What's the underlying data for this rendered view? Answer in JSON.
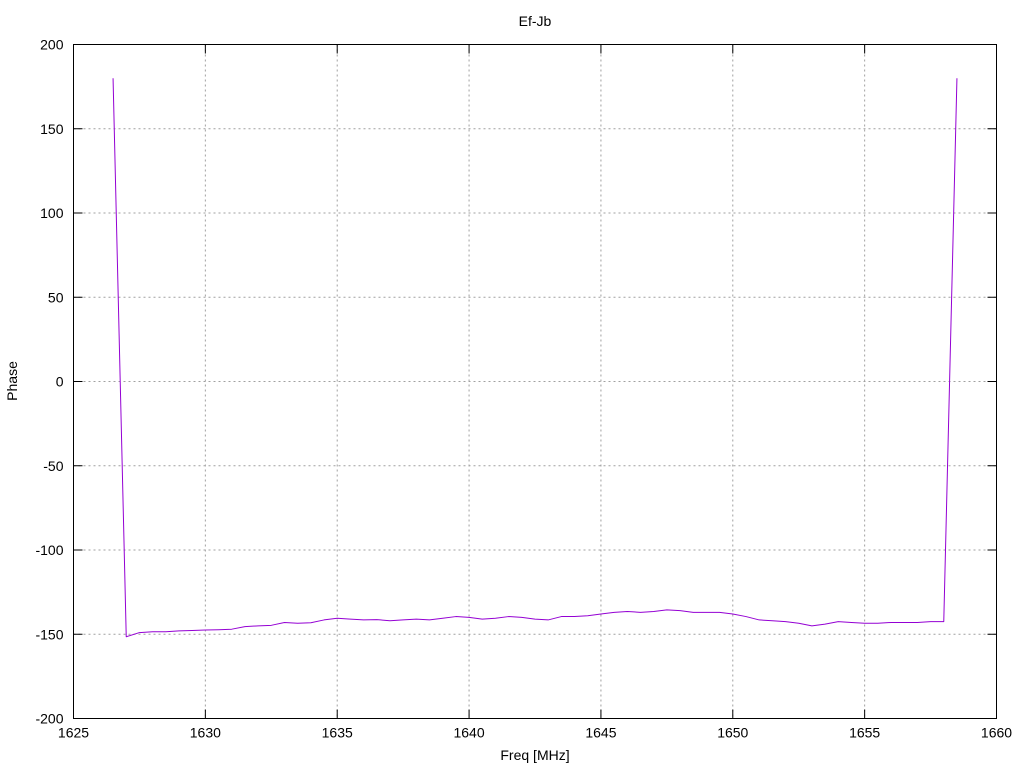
{
  "chart_data": {
    "type": "line",
    "title": "Ef-Jb",
    "xlabel": "Freq [MHz]",
    "ylabel": "Phase",
    "xlim": [
      1625,
      1660
    ],
    "ylim": [
      -200,
      200
    ],
    "xticks": [
      1625,
      1630,
      1635,
      1640,
      1645,
      1650,
      1655,
      1660
    ],
    "yticks": [
      -200,
      -150,
      -100,
      -50,
      0,
      50,
      100,
      150,
      200
    ],
    "grid": true,
    "legend": "none",
    "series": [
      {
        "color": "#9400d3",
        "x": [
          1626.5,
          1627.0,
          1627.5,
          1628.0,
          1628.5,
          1629.0,
          1629.5,
          1630.0,
          1630.5,
          1631.0,
          1631.5,
          1632.0,
          1632.5,
          1633.0,
          1633.5,
          1634.0,
          1634.5,
          1635.0,
          1635.5,
          1636.0,
          1636.5,
          1637.0,
          1637.5,
          1638.0,
          1638.5,
          1639.0,
          1639.5,
          1640.0,
          1640.5,
          1641.0,
          1641.5,
          1642.0,
          1642.5,
          1643.0,
          1643.5,
          1644.0,
          1644.5,
          1645.0,
          1645.5,
          1646.0,
          1646.5,
          1647.0,
          1647.5,
          1648.0,
          1648.5,
          1649.0,
          1649.5,
          1650.0,
          1650.5,
          1651.0,
          1651.5,
          1652.0,
          1652.5,
          1653.0,
          1653.5,
          1654.0,
          1654.5,
          1655.0,
          1655.5,
          1656.0,
          1656.5,
          1657.0,
          1657.5,
          1658.0,
          1658.5
        ],
        "values": [
          180,
          -151.5,
          -149,
          -148.5,
          -148.5,
          -148,
          -147.8,
          -147.5,
          -147.3,
          -147,
          -145.5,
          -145,
          -144.7,
          -143,
          -143.5,
          -143.2,
          -141.5,
          -140.5,
          -141,
          -141.5,
          -141.3,
          -142,
          -141.5,
          -141,
          -141.5,
          -140.5,
          -139.5,
          -140,
          -141,
          -140.5,
          -139.5,
          -140,
          -141,
          -141.5,
          -139.5,
          -139.5,
          -139,
          -138,
          -137,
          -136.5,
          -137,
          -136.5,
          -135.5,
          -136,
          -137,
          -137,
          -137,
          -138,
          -139.5,
          -141.5,
          -142,
          -142.5,
          -143.5,
          -145,
          -144,
          -142.5,
          -143,
          -143.5,
          -143.5,
          -143,
          -143,
          -143,
          -142.5,
          -142.5,
          180
        ]
      }
    ]
  }
}
